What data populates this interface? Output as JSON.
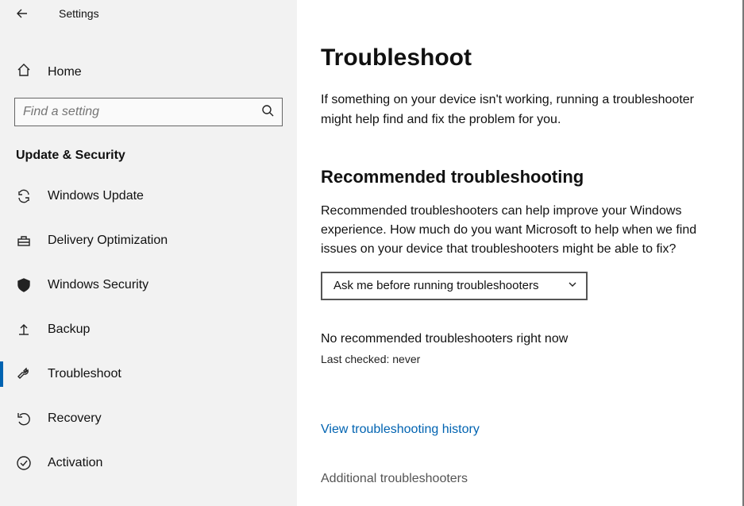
{
  "header": {
    "title": "Settings"
  },
  "sidebar": {
    "home_label": "Home",
    "search_placeholder": "Find a setting",
    "section_title": "Update & Security",
    "items": [
      {
        "label": "Windows Update"
      },
      {
        "label": "Delivery Optimization"
      },
      {
        "label": "Windows Security"
      },
      {
        "label": "Backup"
      },
      {
        "label": "Troubleshoot"
      },
      {
        "label": "Recovery"
      },
      {
        "label": "Activation"
      }
    ]
  },
  "main": {
    "title": "Troubleshoot",
    "intro": "If something on your device isn't working, running a troubleshooter might help find and fix the problem for you.",
    "rec_title": "Recommended troubleshooting",
    "rec_desc": "Recommended troubleshooters can help improve your Windows experience. How much do you want Microsoft to help when we find issues on your device that troubleshooters might be able to fix?",
    "dropdown_value": "Ask me before running troubleshooters",
    "status_main": "No recommended troubleshooters right now",
    "status_sub": "Last checked: never",
    "history_link": "View troubleshooting history",
    "additional_title": "Additional troubleshooters"
  }
}
